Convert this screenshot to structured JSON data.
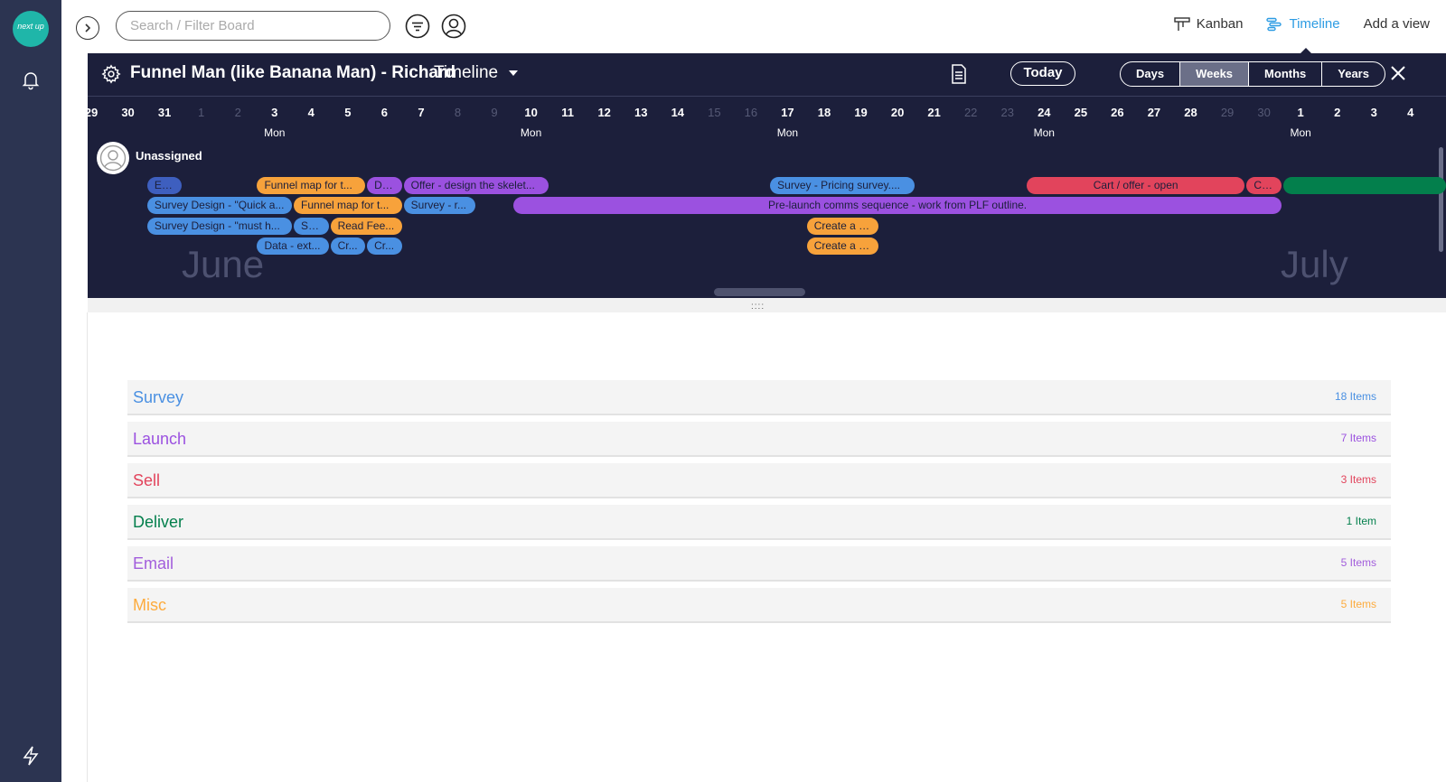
{
  "app": {
    "logo_text": "next up"
  },
  "topbar": {
    "search_placeholder": "Search / Filter Board",
    "views": [
      {
        "label": "Kanban",
        "icon": "kanban-icon",
        "active": false
      },
      {
        "label": "Timeline",
        "icon": "timeline-icon",
        "active": true
      },
      {
        "label": "Add a view",
        "icon": "",
        "active": false
      }
    ]
  },
  "timeline": {
    "board_title": "Funnel Man (like Banana Man) - Richard",
    "view_label": "Timeline",
    "today_label": "Today",
    "ranges": [
      {
        "label": "Days",
        "active": false
      },
      {
        "label": "Weeks",
        "active": true
      },
      {
        "label": "Months",
        "active": false
      },
      {
        "label": "Years",
        "active": false
      }
    ],
    "days": [
      {
        "d": "29",
        "w": false
      },
      {
        "d": "30",
        "w": false
      },
      {
        "d": "31",
        "w": false
      },
      {
        "d": "1",
        "w": true
      },
      {
        "d": "2",
        "w": true
      },
      {
        "d": "3",
        "w": false,
        "mon": "Mon"
      },
      {
        "d": "4",
        "w": false
      },
      {
        "d": "5",
        "w": false
      },
      {
        "d": "6",
        "w": false
      },
      {
        "d": "7",
        "w": false
      },
      {
        "d": "8",
        "w": true
      },
      {
        "d": "9",
        "w": true
      },
      {
        "d": "10",
        "w": false,
        "mon": "Mon"
      },
      {
        "d": "11",
        "w": false
      },
      {
        "d": "12",
        "w": false
      },
      {
        "d": "13",
        "w": false
      },
      {
        "d": "14",
        "w": false
      },
      {
        "d": "15",
        "w": true
      },
      {
        "d": "16",
        "w": true
      },
      {
        "d": "17",
        "w": false,
        "mon": "Mon"
      },
      {
        "d": "18",
        "w": false
      },
      {
        "d": "19",
        "w": false
      },
      {
        "d": "20",
        "w": false
      },
      {
        "d": "21",
        "w": false
      },
      {
        "d": "22",
        "w": true
      },
      {
        "d": "23",
        "w": true
      },
      {
        "d": "24",
        "w": false,
        "mon": "Mon"
      },
      {
        "d": "25",
        "w": false
      },
      {
        "d": "26",
        "w": false
      },
      {
        "d": "27",
        "w": false
      },
      {
        "d": "28",
        "w": false
      },
      {
        "d": "29",
        "w": true
      },
      {
        "d": "30",
        "w": true
      },
      {
        "d": "1",
        "w": false,
        "mon": "Mon"
      },
      {
        "d": "2",
        "w": false
      },
      {
        "d": "3",
        "w": false
      },
      {
        "d": "4",
        "w": false
      }
    ],
    "months": [
      "June",
      "July"
    ],
    "unassigned_label": "Unassigned",
    "bars": [
      {
        "label": "En...",
        "start": 1.5,
        "span": 1,
        "row": 0,
        "color": "#3e5fbf"
      },
      {
        "label": "Funnel map for t...",
        "start": 4.5,
        "span": 3,
        "row": 0,
        "color": "#f7a23b"
      },
      {
        "label": "De...",
        "start": 7.5,
        "span": 1,
        "row": 0,
        "color": "#9b51e0"
      },
      {
        "label": "Offer - design the skelet...",
        "start": 8.5,
        "span": 4,
        "row": 0,
        "color": "#9b51e0"
      },
      {
        "label": "Survey - Pricing survey....",
        "start": 18.5,
        "span": 4,
        "row": 0,
        "color": "#4a90e2"
      },
      {
        "label": "Cart / offer - open",
        "start": 25.5,
        "span": 6,
        "row": 0,
        "color": "#e2445c",
        "center": true
      },
      {
        "label": "Ca...",
        "start": 31.5,
        "span": 1,
        "row": 0,
        "color": "#e2445c"
      },
      {
        "label": "",
        "start": 32.5,
        "span": 4.5,
        "row": 0,
        "color": "#037f4c"
      },
      {
        "label": "Survey Design - \"Quick a...",
        "start": 1.5,
        "span": 4,
        "row": 1,
        "color": "#4a90e2"
      },
      {
        "label": "Funnel map for t...",
        "start": 5.5,
        "span": 3,
        "row": 1,
        "color": "#f7a23b"
      },
      {
        "label": "Survey - r...",
        "start": 8.5,
        "span": 2,
        "row": 1,
        "color": "#4a90e2"
      },
      {
        "label": "Pre-launch comms sequence - work from PLF outline.",
        "start": 11.5,
        "span": 21,
        "row": 1,
        "color": "#9b51e0",
        "center": true
      },
      {
        "label": "Survey Design - \"must h...",
        "start": 1.5,
        "span": 4,
        "row": 2,
        "color": "#4a90e2"
      },
      {
        "label": "Su...",
        "start": 5.5,
        "span": 1,
        "row": 2,
        "color": "#4a90e2"
      },
      {
        "label": "Read Fee...",
        "start": 6.5,
        "span": 2,
        "row": 2,
        "color": "#f7a23b"
      },
      {
        "label": "Create a \"...",
        "start": 19.5,
        "span": 2,
        "row": 2,
        "color": "#f7a23b"
      },
      {
        "label": "Data - ext...",
        "start": 4.5,
        "span": 2,
        "row": 3,
        "color": "#4a90e2"
      },
      {
        "label": "Cr...",
        "start": 6.5,
        "span": 1,
        "row": 3,
        "color": "#4a90e2"
      },
      {
        "label": "Cr...",
        "start": 7.5,
        "span": 1,
        "row": 3,
        "color": "#4a90e2"
      },
      {
        "label": "Create a \"...",
        "start": 19.5,
        "span": 2,
        "row": 3,
        "color": "#f7a23b"
      }
    ]
  },
  "groups": [
    {
      "name": "Survey",
      "count": "18 Items",
      "color": "#4a90e2"
    },
    {
      "name": "Launch",
      "count": "7 Items",
      "color": "#9b51e0"
    },
    {
      "name": "Sell",
      "count": "3 Items",
      "color": "#e2445c"
    },
    {
      "name": "Deliver",
      "count": "1 Item",
      "color": "#037f4c"
    },
    {
      "name": "Email",
      "count": "5 Items",
      "color": "#a25ddc"
    },
    {
      "name": "Misc",
      "count": "5 Items",
      "color": "#fdab3d"
    }
  ]
}
